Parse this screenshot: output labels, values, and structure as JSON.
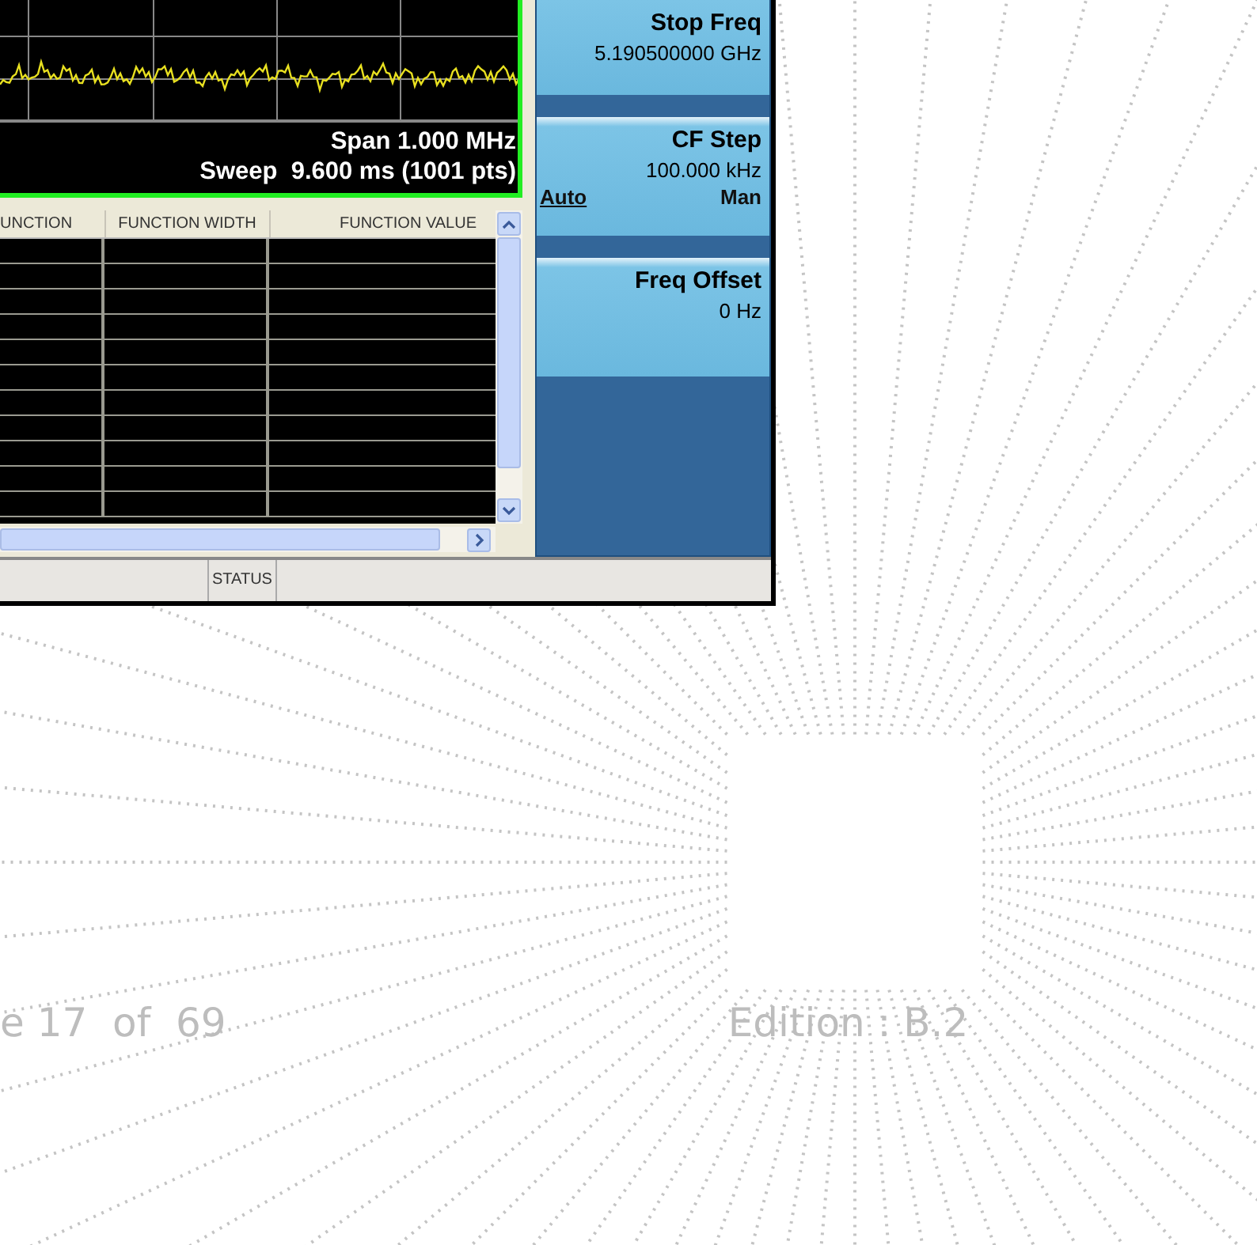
{
  "trace_display": {
    "span": "Span 1.000 MHz",
    "sweep": "Sweep  9.600 ms (1001 pts)"
  },
  "table": {
    "columns": [
      "UNCTION",
      "FUNCTION WIDTH",
      "FUNCTION VALUE"
    ]
  },
  "softkeys": [
    {
      "kind": "value",
      "label": "Stop Freq",
      "value": "5.190500000 GHz"
    },
    {
      "kind": "toggle",
      "label": "CF Step",
      "value": "100.000 kHz",
      "options": [
        {
          "label": "Auto",
          "selected": true
        },
        {
          "label": "Man",
          "selected": false
        }
      ]
    },
    {
      "kind": "value",
      "label": "Freq Offset",
      "value": "0 Hz"
    }
  ],
  "status_bar": {
    "label": "STATUS"
  },
  "page_footer": {
    "page": "e 17  of  69",
    "edition": "Edition : B.2"
  }
}
